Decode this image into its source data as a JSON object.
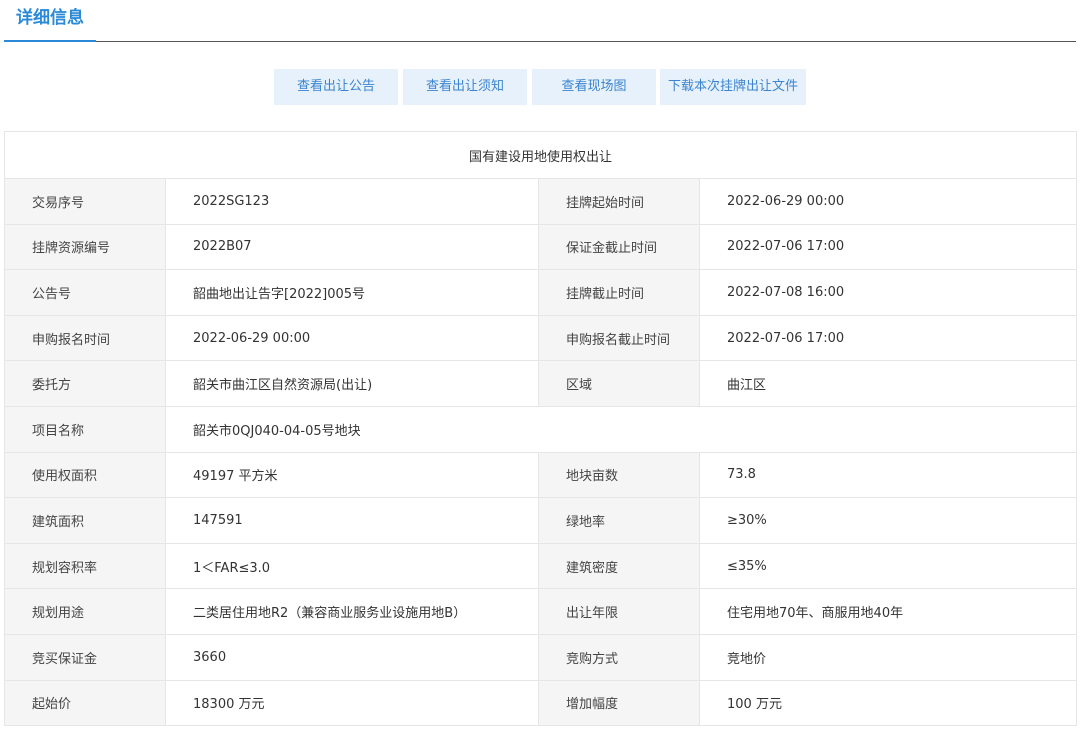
{
  "header": {
    "title": "详细信息"
  },
  "buttons": [
    {
      "label": "查看出让公告"
    },
    {
      "label": "查看出让须知"
    },
    {
      "label": "查看现场图"
    },
    {
      "label": "下载本次挂牌出让文件"
    }
  ],
  "table": {
    "title": "国有建设用地使用权出让",
    "rows": [
      {
        "l1": "交易序号",
        "v1": "2022SG123",
        "l2": "挂牌起始时间",
        "v2": "2022-06-29 00:00"
      },
      {
        "l1": "挂牌资源编号",
        "v1": "2022B07",
        "l2": "保证金截止时间",
        "v2": "2022-07-06 17:00"
      },
      {
        "l1": "公告号",
        "v1": "韶曲地出让告字[2022]005号",
        "l2": "挂牌截止时间",
        "v2": "2022-07-08 16:00"
      },
      {
        "l1": "申购报名时间",
        "v1": "2022-06-29 00:00",
        "l2": "申购报名截止时间",
        "v2": "2022-07-06 17:00"
      },
      {
        "l1": "委托方",
        "v1": "韶关市曲江区自然资源局(出让)",
        "l2": "区域",
        "v2": "曲江区"
      },
      {
        "l1": "项目名称",
        "v1": "韶关市0QJ040-04-05号地块"
      },
      {
        "l1": "使用权面积",
        "v1": "49197 平方米",
        "l2": "地块亩数",
        "v2": "73.8"
      },
      {
        "l1": "建筑面积",
        "v1": "147591",
        "l2": "绿地率",
        "v2": "≥30%"
      },
      {
        "l1": "规划容积率",
        "v1": "1＜FAR≤3.0",
        "l2": "建筑密度",
        "v2": "≤35%"
      },
      {
        "l1": "规划用途",
        "v1": "二类居住用地R2（兼容商业服务业设施用地B）",
        "l2": "出让年限",
        "v2": "住宅用地70年、商服用地40年"
      },
      {
        "l1": "竞买保证金",
        "v1": "3660",
        "l2": "竞购方式",
        "v2": "竞地价"
      },
      {
        "l1": "起始价",
        "v1": "18300 万元",
        "l2": "增加幅度",
        "v2": "100 万元"
      }
    ]
  }
}
